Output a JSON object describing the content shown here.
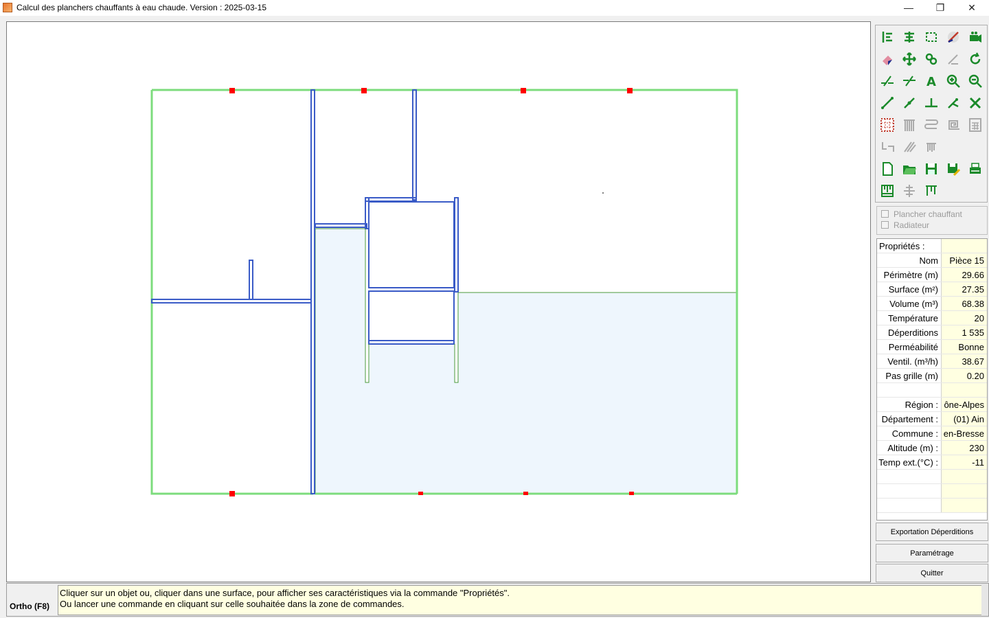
{
  "window": {
    "title": "Calcul des planchers chauffants à eau chaude. Version : 2025-03-15",
    "minimize_glyph": "—",
    "maximize_glyph": "❐",
    "close_glyph": "✕"
  },
  "colors": {
    "outer_wall": "#7ddc7d",
    "inner_wall": "#3a5bc7",
    "heated_zone_fill": "#eef6fd",
    "heated_zone_stroke": "#4a9a3a",
    "marker": "#ff0000",
    "property_value_bg": "#ffffe1"
  },
  "toolbar": {
    "rows": [
      [
        "wall-left-icon",
        "wall-center-icon",
        "wall-rect-icon",
        "compass-icon",
        "camera-icon"
      ],
      [
        "eraser-icon",
        "move-icon",
        "rotate-link-icon",
        "pen-disabled-icon",
        "rotate-icon"
      ],
      [
        "split-line-icon",
        "split-line-alt-icon",
        "text-icon",
        "zoom-in-icon",
        "zoom-out-icon"
      ],
      [
        "line-icon",
        "line-node-icon",
        "tee-icon",
        "snap-icon",
        "cross-icon"
      ],
      [
        "grid-icon",
        "radiator-icon",
        "serpentine-icon",
        "spiral-icon",
        "calculator-icon"
      ],
      [
        "collector-icon",
        "pipe-icon",
        "manifold-icon"
      ],
      [
        "new-file-icon",
        "open-folder-icon",
        "save-icon",
        "save-as-icon",
        "print-icon"
      ],
      [
        "export-plan-icon",
        "dimension-icon",
        "distribution-icon"
      ]
    ]
  },
  "checks": {
    "plancher": "Plancher chauffant",
    "radiateur": "Radiateur"
  },
  "properties": {
    "header": "Propriétés :",
    "rows": [
      {
        "label": "Nom",
        "value": "Pièce 15"
      },
      {
        "label": "Périmètre (m)",
        "value": "29.66"
      },
      {
        "label": "Surface (m²)",
        "value": "27.35"
      },
      {
        "label": "Volume (m³)",
        "value": "68.38"
      },
      {
        "label": "Température",
        "value": "20"
      },
      {
        "label": "Déperditions",
        "value": "1 535"
      },
      {
        "label": "Perméabilité",
        "value": "Bonne"
      },
      {
        "label": "Ventil. (m³/h)",
        "value": "38.67"
      },
      {
        "label": "Pas grille (m)",
        "value": "0.20"
      },
      {
        "label": "",
        "value": ""
      },
      {
        "label": "Région :",
        "value": "ône-Alpes"
      },
      {
        "label": "Département :",
        "value": "(01) Ain"
      },
      {
        "label": "Commune :",
        "value": "en-Bresse"
      },
      {
        "label": "Altitude (m) :",
        "value": "230"
      },
      {
        "label": "Temp ext.(°C) :",
        "value": "-11"
      }
    ]
  },
  "buttons": {
    "export": "Exportation Déperditions",
    "settings": "Paramétrage",
    "quit": "Quitter"
  },
  "status": {
    "ortho": "Ortho (F8)",
    "line1": "Cliquer sur un objet ou, cliquer dans une surface, pour afficher ses caractéristiques via la commande \"Propriétés\".",
    "line2": "Ou lancer une commande en cliquant sur celle souhaitée dans la zone de commandes."
  }
}
